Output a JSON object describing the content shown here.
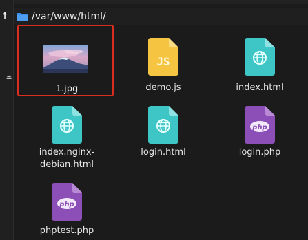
{
  "pathbar": {
    "path": "/var/www/html/",
    "folder_icon": "folder-icon",
    "folder_color": "#3b8eea"
  },
  "sidebar": {
    "back_icon": "up-arrow-icon",
    "eject_icon": "eject-icon"
  },
  "files": [
    {
      "name": "1.jpg",
      "type": "image",
      "selected": true
    },
    {
      "name": "demo.js",
      "type": "javascript",
      "color": "#f5c542"
    },
    {
      "name": "index.html",
      "type": "html",
      "color": "#3ec6c6"
    },
    {
      "name": "index.nginx-\ndebian.html",
      "type": "html",
      "color": "#3ec6c6"
    },
    {
      "name": "login.html",
      "type": "html",
      "color": "#3ec6c6"
    },
    {
      "name": "login.php",
      "type": "php",
      "color": "#8c4fb7"
    },
    {
      "name": "phptest.php",
      "type": "php",
      "color": "#8c4fb7"
    }
  ],
  "selection_color": "#d92d20"
}
